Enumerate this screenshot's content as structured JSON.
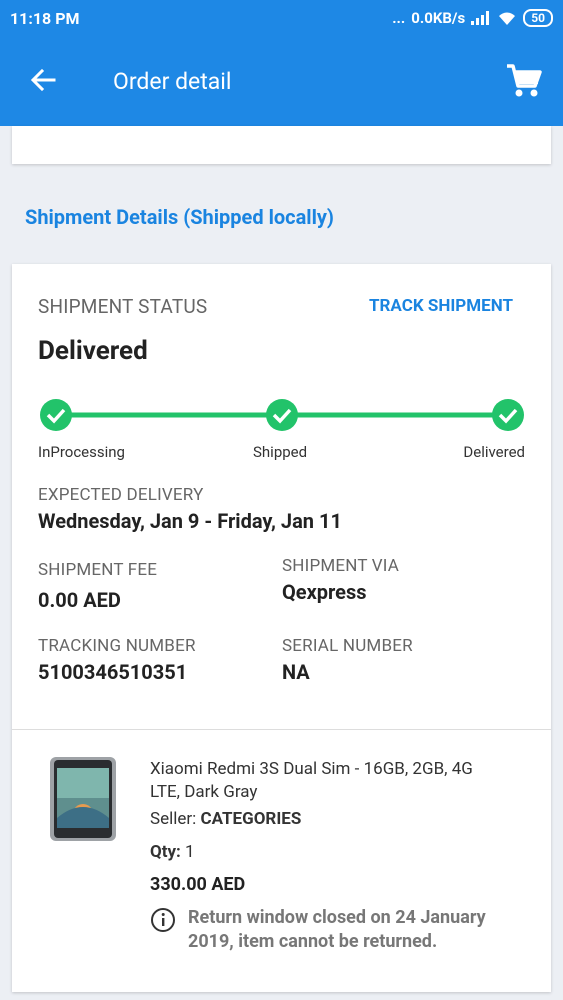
{
  "status_bar": {
    "time": "11:18 PM",
    "dots": "...",
    "net_speed": "0.0KB/s",
    "battery": "50"
  },
  "app_bar": {
    "title": "Order detail",
    "back_icon": "arrow-left-icon",
    "cart_icon": "shopping-cart-icon"
  },
  "shipment": {
    "section_title": "Shipment Details (Shipped locally)",
    "status_label": "SHIPMENT STATUS",
    "track_button": "TRACK SHIPMENT",
    "status_value": "Delivered",
    "steps": [
      {
        "label": "InProcessing"
      },
      {
        "label": "Shipped"
      },
      {
        "label": "Delivered"
      }
    ],
    "expected_delivery_label": "EXPECTED DELIVERY",
    "expected_delivery_value": "Wednesday, Jan 9 - Friday, Jan 11",
    "fee_label": "SHIPMENT FEE",
    "fee_value": "0.00 AED",
    "via_label": "SHIPMENT VIA",
    "via_value": "Qexpress",
    "tracking_label": "TRACKING NUMBER",
    "tracking_value": "5100346510351",
    "serial_label": "SERIAL NUMBER",
    "serial_value": "NA",
    "step_color": "#22c36a"
  },
  "product": {
    "title_line1": "Xiaomi Redmi 3S Dual Sim - 16GB, 2GB, 4G",
    "title_line2": "LTE, Dark Gray",
    "seller_label": "Seller:",
    "seller_value": "CATEGORIES",
    "qty_label": "Qty:",
    "qty_value": "1",
    "price": "330.00 AED",
    "return_note_line1": "Return window closed on 24 January",
    "return_note_line2": "2019, item cannot be returned."
  }
}
